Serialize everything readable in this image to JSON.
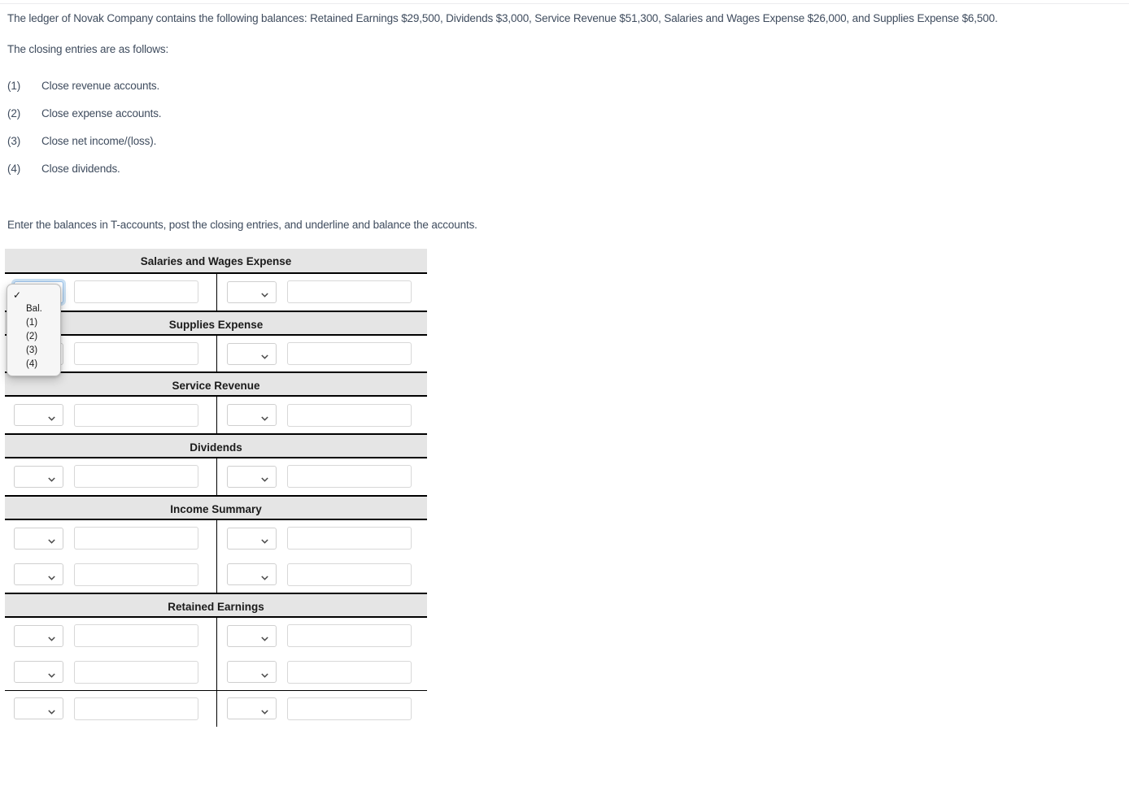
{
  "document": {
    "intro_paragraph": "The ledger of Novak Company contains the following balances: Retained Earnings $29,500, Dividends $3,000, Service Revenue $51,300, Salaries and Wages Expense $26,000, and Supplies Expense $6,500.",
    "closing_entries_lead": "The closing entries are as follows:",
    "instruction": "Enter the balances in T-accounts, post the closing entries, and underline and balance the accounts."
  },
  "closing_entries": [
    {
      "number": "(1)",
      "text": "Close revenue accounts."
    },
    {
      "number": "(2)",
      "text": "Close expense accounts."
    },
    {
      "number": "(3)",
      "text": "Close net income/(loss)."
    },
    {
      "number": "(4)",
      "text": "Close dividends."
    }
  ],
  "t_accounts": [
    {
      "title": "Salaries and Wages Expense",
      "rows": [
        {
          "left_select": "",
          "left_amount": "",
          "right_select": "",
          "right_amount": "",
          "underline_after": false
        }
      ]
    },
    {
      "title": "Supplies Expense",
      "rows": [
        {
          "left_select": "",
          "left_amount": "",
          "right_select": "",
          "right_amount": "",
          "underline_after": false
        }
      ]
    },
    {
      "title": "Service Revenue",
      "rows": [
        {
          "left_select": "",
          "left_amount": "",
          "right_select": "",
          "right_amount": "",
          "underline_after": false
        }
      ]
    },
    {
      "title": "Dividends",
      "rows": [
        {
          "left_select": "",
          "left_amount": "",
          "right_select": "",
          "right_amount": "",
          "underline_after": false
        }
      ]
    },
    {
      "title": "Income Summary",
      "rows": [
        {
          "left_select": "",
          "left_amount": "",
          "right_select": "",
          "right_amount": "",
          "underline_after": false
        },
        {
          "left_select": "",
          "left_amount": "",
          "right_select": "",
          "right_amount": "",
          "underline_after": false
        }
      ]
    },
    {
      "title": "Retained Earnings",
      "rows": [
        {
          "left_select": "",
          "left_amount": "",
          "right_select": "",
          "right_amount": "",
          "underline_after": false
        },
        {
          "left_select": "",
          "left_amount": "",
          "right_select": "",
          "right_amount": "",
          "underline_after": true
        },
        {
          "left_select": "",
          "left_amount": "",
          "right_select": "",
          "right_amount": "",
          "underline_after": false
        }
      ]
    }
  ],
  "open_dropdown": {
    "anchor": "salaries-and-wages-expense-row-0-left-select",
    "selected_index": 0,
    "options": [
      {
        "label": "",
        "checked": true
      },
      {
        "label": "Bal.",
        "checked": false
      },
      {
        "label": "(1)",
        "checked": false
      },
      {
        "label": "(2)",
        "checked": false
      },
      {
        "label": "(3)",
        "checked": false
      },
      {
        "label": "(4)",
        "checked": false
      }
    ],
    "check_glyph": "✓"
  },
  "colors": {
    "body_text": "#3f4c5e",
    "account_header_bg": "#e5e5e5",
    "rule": "#000000",
    "focus_ring": "#6aa8e0"
  }
}
